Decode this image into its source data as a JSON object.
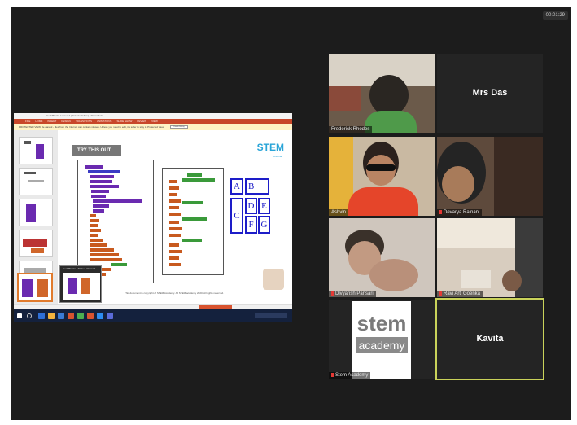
{
  "meeting": {
    "timer": "00:01:29"
  },
  "shared_screen": {
    "window_title": "CodeBlocks Lesson 4 (Protected View) - PowerPoint",
    "ribbon_tabs": [
      "FILE",
      "HOME",
      "INSERT",
      "DESIGN",
      "TRANSITIONS",
      "ANIMATIONS",
      "SLIDE SHOW",
      "REVIEW",
      "VIEW"
    ],
    "protected_view_text": "PROTECTED VIEW  Be careful - files from the Internet can contain viruses. Unless you need to edit, it's safer to stay in Protected View.",
    "enable_editing": "Enable Editing",
    "slide_heading": "TRY THIS OUT",
    "logo_text": "STEM",
    "logo_sub": "ONLINE",
    "grid_letters": [
      "A",
      "B",
      "C",
      "D",
      "E",
      "F",
      "G"
    ],
    "copyright": "This document is copyright of STEM Academy. All STEM academy 2020. All rights reserved.",
    "preview_title": "CodeBlocks - Slides - PowerP..."
  },
  "participants": [
    {
      "name": "Frederick Rhodes",
      "video": true
    },
    {
      "name": "Mrs Das",
      "video": false
    },
    {
      "name": "Ashvin",
      "video": true
    },
    {
      "name": "Devarya Rainani",
      "video": true,
      "muted": true
    },
    {
      "name": "Divyansh Pansari",
      "video": true,
      "muted": true
    },
    {
      "name": "Ravi Arti Goenka",
      "video": true,
      "muted": true
    },
    {
      "name": "Stem Academy",
      "video": true,
      "muted": true,
      "logo_line1": "stem",
      "logo_line2": "academy"
    },
    {
      "name": "Kavita",
      "video": false,
      "active_speaker": true
    }
  ],
  "colors": {
    "active_speaker_border": "#c9d25a",
    "tile_bg": "#242424",
    "muted_icon": "#e53935"
  }
}
